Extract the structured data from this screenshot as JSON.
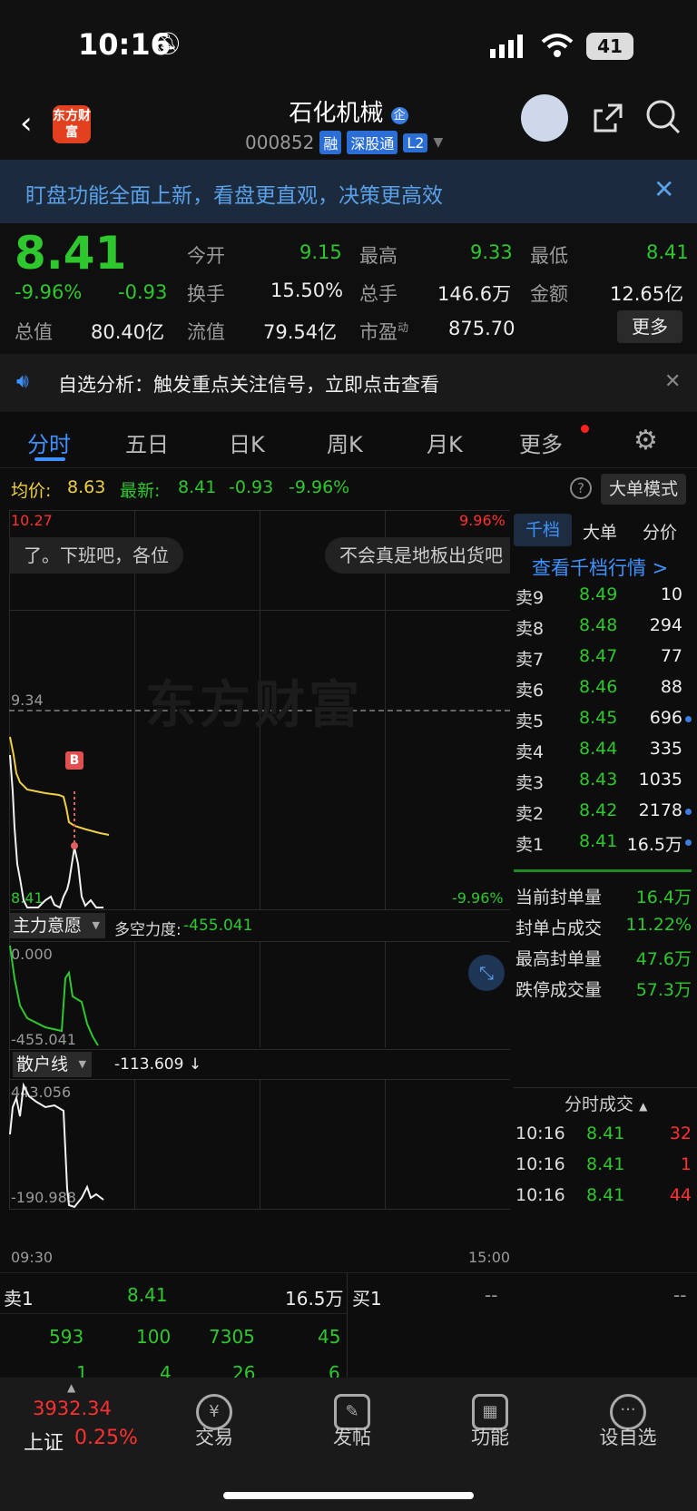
{
  "status": {
    "time": "10:16",
    "battery": "41"
  },
  "header": {
    "title": "石化机械",
    "code": "000852",
    "tags": [
      "融",
      "深股通",
      "L2"
    ],
    "logo_text": "东方财富",
    "badge": "企"
  },
  "banner": {
    "text": "盯盘功能全面上新，看盘更直观，决策更高效"
  },
  "quote": {
    "price": "8.41",
    "change_pct": "-9.96%",
    "change": "-0.93",
    "open_label": "今开",
    "open": "9.15",
    "high_label": "最高",
    "high": "9.33",
    "low_label": "最低",
    "low": "8.41",
    "turnover_label": "换手",
    "turnover": "15.50%",
    "volume_label": "总手",
    "volume": "146.6万",
    "amount_label": "金额",
    "amount": "12.65亿",
    "mktcap_label": "总值",
    "mktcap": "80.40亿",
    "float_label": "流值",
    "float": "79.54亿",
    "pe_label": "市盈",
    "pe_sup": "动",
    "pe": "875.70",
    "more": "更多"
  },
  "alert": {
    "text": "自选分析：触发重点关注信号，立即点击查看"
  },
  "tabs": [
    "分时",
    "五日",
    "日K",
    "周K",
    "月K",
    "更多"
  ],
  "inforow": {
    "avg_label": "均价:",
    "avg": "8.63",
    "latest_label": "最新:",
    "latest": "8.41",
    "chg": "-0.93",
    "pct": "-9.96%",
    "big_order": "大单模式"
  },
  "chart": {
    "top_left": "10.27",
    "top_right": "9.96%",
    "mid": "9.34",
    "bottom_left": "8.41",
    "bottom_right": "-9.96%",
    "watermark": "东方财富",
    "danmu1": "了。下班吧，各位",
    "danmu2": "不会真是地板出货吧",
    "marker": "B",
    "ind1_name": "主力意愿",
    "ind1_label": "多空力度:",
    "ind1_value": "-455.041",
    "ind1_top": "0.000",
    "ind1_bottom": "-455.041",
    "ind2_name": "散户线",
    "ind2_value": "-113.609 ↓",
    "ind2_top": "443.056",
    "ind2_bottom": "-190.988",
    "time_start": "09:30",
    "time_end": "15:00"
  },
  "book": {
    "tabs": [
      "千档",
      "大单",
      "分价"
    ],
    "link": "查看千档行情 >",
    "asks": [
      {
        "label": "卖9",
        "price": "8.49",
        "vol": "10"
      },
      {
        "label": "卖8",
        "price": "8.48",
        "vol": "294"
      },
      {
        "label": "卖7",
        "price": "8.47",
        "vol": "77"
      },
      {
        "label": "卖6",
        "price": "8.46",
        "vol": "88"
      },
      {
        "label": "卖5",
        "price": "8.45",
        "vol": "696"
      },
      {
        "label": "卖4",
        "price": "8.44",
        "vol": "335"
      },
      {
        "label": "卖3",
        "price": "8.43",
        "vol": "1035"
      },
      {
        "label": "卖2",
        "price": "8.42",
        "vol": "2178"
      },
      {
        "label": "卖1",
        "price": "8.41",
        "vol": "16.5万"
      }
    ],
    "stats": [
      {
        "label": "当前封单量",
        "value": "16.4万"
      },
      {
        "label": "封单占成交",
        "value": "11.22%"
      },
      {
        "label": "最高封单量",
        "value": "47.6万"
      },
      {
        "label": "跌停成交量",
        "value": "57.3万"
      }
    ],
    "trades_title": "分时成交",
    "trades": [
      {
        "time": "10:16",
        "price": "8.41",
        "vol": "32"
      },
      {
        "time": "10:16",
        "price": "8.41",
        "vol": "1"
      },
      {
        "time": "10:16",
        "price": "8.41",
        "vol": "44"
      }
    ]
  },
  "summary": {
    "sell1_label": "卖1",
    "sell1_price": "8.41",
    "sell1_vol": "16.5万",
    "buy1_label": "买1",
    "buy1_price": "--",
    "buy1_vol": "--",
    "row1": [
      "593",
      "100",
      "7305",
      "45"
    ],
    "row2": [
      "1",
      "4",
      "26",
      "6"
    ]
  },
  "nav": {
    "index_value": "3932.34",
    "index_name": "上证",
    "index_pct": "0.25%",
    "items": [
      "交易",
      "发帖",
      "功能",
      "设自选"
    ]
  }
}
